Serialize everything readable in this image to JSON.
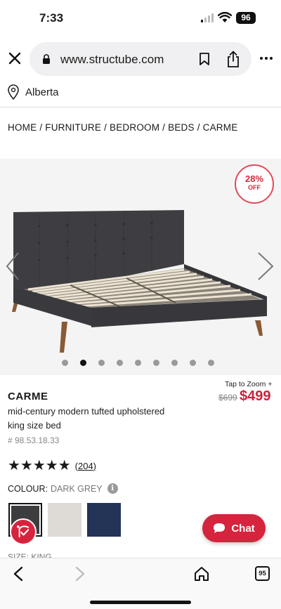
{
  "status_bar": {
    "time": "7:33",
    "battery": "96"
  },
  "browser": {
    "url": "www.structube.com",
    "tab_count": "95"
  },
  "location": {
    "label": "Alberta"
  },
  "breadcrumb": [
    "HOME",
    "FURNITURE",
    "BEDROOM",
    "BEDS",
    "CARME"
  ],
  "gallery": {
    "discount_pct": "28%",
    "discount_off": "OFF",
    "image_count": 9,
    "active_index": 1,
    "tap_zoom": "Tap to Zoom +"
  },
  "product": {
    "name": "CARME",
    "description": "mid-century modern tufted upholstered king size bed",
    "sku": "# 98.53.18.33",
    "old_price": "$699",
    "new_price": "$499",
    "rating_stars": 5,
    "review_count": "(204)",
    "stars_text": "★★★★★"
  },
  "colour": {
    "label": "COLOUR:",
    "selected": "DARK GREY",
    "info_glyph": "i",
    "swatches": [
      {
        "name": "dark grey",
        "color": "#3d3d40"
      },
      {
        "name": "light grey",
        "color": "#dedad6"
      },
      {
        "name": "navy",
        "color": "#233456"
      }
    ]
  },
  "size": {
    "label": "SIZE: KING"
  },
  "chat": {
    "label": "Chat"
  },
  "colors": {
    "accent": "#d6243e",
    "price": "#d0213a"
  }
}
